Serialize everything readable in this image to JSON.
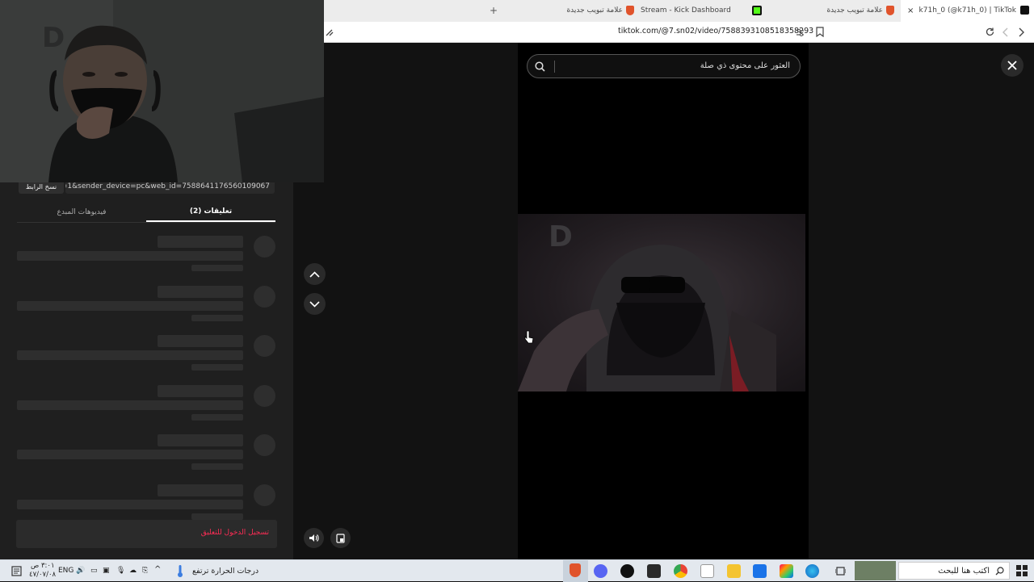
{
  "browser": {
    "tabs": [
      {
        "label": "k71h_0 (@k71h_0) | TikTok",
        "active": true
      },
      {
        "label": "علامة تبويب جديدة",
        "active": false
      },
      {
        "label": "Stream - Kick Dashboard",
        "active": false
      },
      {
        "label": "علامة تبويب جديدة",
        "active": false
      }
    ],
    "new_tab_symbol": "+",
    "close_tab_symbol": "×",
    "url": "tiktok.com/@7.sn02/video/7588393108518358293"
  },
  "left_panel": {
    "copy_link_label": "نسخ الرابط",
    "link_value": "...p=1&sender_device=pc&web_id=7588641176560109067",
    "tabs": [
      {
        "label": "تعليقات (2)",
        "active": true
      },
      {
        "label": "فيديوهات المبدع",
        "active": false
      }
    ],
    "login_to_comment": "تسجيل الدخول للتعليق"
  },
  "main": {
    "search_placeholder": "العثور على محتوى ذي صلة"
  },
  "taskbar": {
    "search_placeholder": "اكتب هنا للبحث",
    "weather_text": "درجات الحرارة ترتفع",
    "language": "ENG",
    "time": "٣:٠١ ص",
    "date": "٤٧/٠٧/٠٨"
  },
  "colors": {
    "accent": "#fe2c55",
    "page_bg": "#121212",
    "panel_bg": "#1f1f1f"
  },
  "icons": [
    "search-icon",
    "close-icon",
    "chevron-up-icon",
    "chevron-down-icon",
    "volume-icon",
    "pip-icon",
    "reload-icon",
    "back-icon",
    "forward-icon",
    "bookmark-icon",
    "windows-icon"
  ]
}
